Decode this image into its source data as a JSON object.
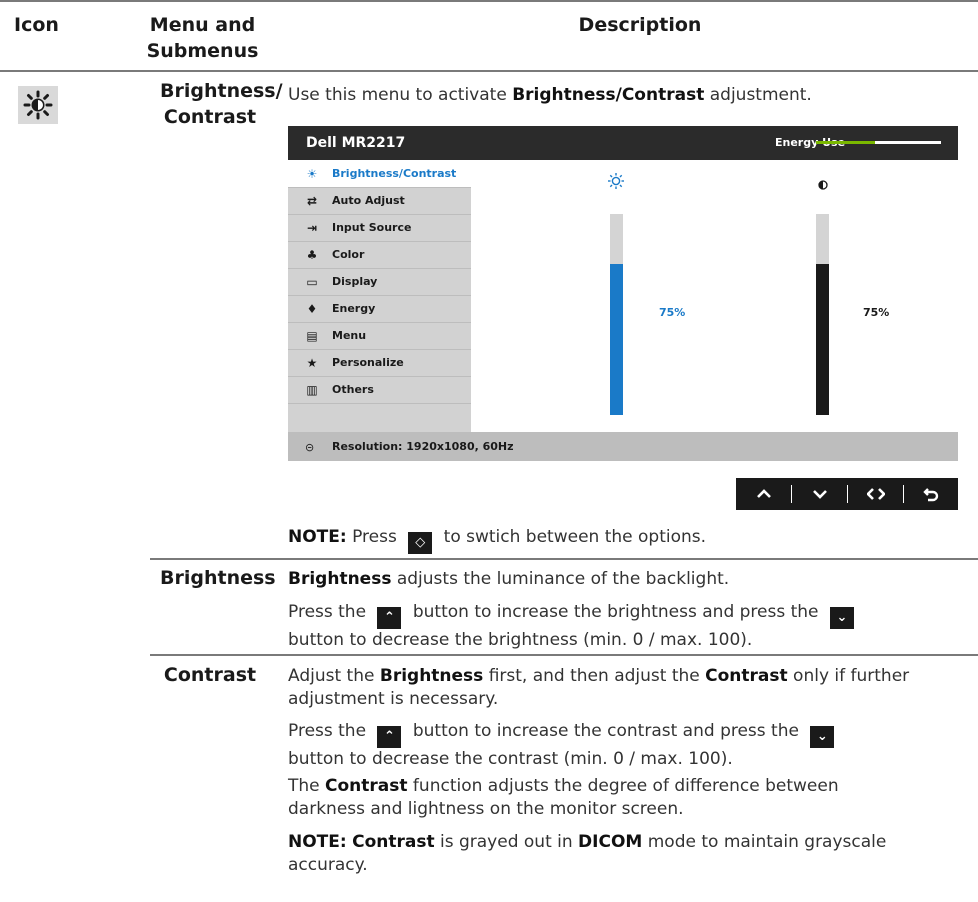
{
  "table": {
    "headers": {
      "icon": "Icon",
      "menu": "Menu and\nSubmenus",
      "menu_line1": "Menu and",
      "menu_line2": "Submenus",
      "description": "Description"
    }
  },
  "rows": {
    "brightness_contrast": {
      "menu_line1": "Brightness/",
      "menu_line2": "Contrast",
      "intro_prefix": "Use this menu to activate ",
      "intro_bold": "Brightness/Contrast",
      "intro_suffix": " adjustment.",
      "note_label": "NOTE:",
      "note_pre": " Press ",
      "note_post": " to swtich between the options."
    },
    "brightness": {
      "menu": "Brightness",
      "p1_bold": "Brightness",
      "p1_rest": " adjusts the luminance of the backlight.",
      "p2_pre": "Press the ",
      "p2_mid": " button to increase the brightness and press the ",
      "p2_line2": "button to decrease the brightness (min. 0 / max. 100)."
    },
    "contrast": {
      "menu": "Contrast",
      "p1_a": "Adjust the ",
      "p1_b": "Brightness",
      "p1_c": " first, and then adjust the ",
      "p1_d": "Contrast",
      "p1_e": " only if further",
      "p1_line2": "adjustment is necessary.",
      "p2_pre": "Press the ",
      "p2_mid": " button to increase the contrast and press the ",
      "p2_line2": "button to decrease the contrast (min. 0 / max. 100).",
      "p3_a": "The ",
      "p3_b": "Contrast",
      "p3_c": " function adjusts the degree of difference between",
      "p3_line2": "darkness and lightness on the monitor screen.",
      "note_label": "NOTE:",
      "note_b": "Contrast",
      "note_c": " is grayed out in ",
      "note_d": "DICOM",
      "note_e": " mode to maintain grayscale",
      "note_line2": "accuracy."
    }
  },
  "osd": {
    "title": "Dell MR2217",
    "energy_label": "Energy Use",
    "energy_level": 0.47,
    "menu_items": [
      {
        "label": "Brightness/Contrast",
        "icon": "sun-icon",
        "glyph": "☀",
        "active": true
      },
      {
        "label": "Auto Adjust",
        "icon": "auto-adjust-icon",
        "glyph": "⇄",
        "active": false
      },
      {
        "label": "Input Source",
        "icon": "input-source-icon",
        "glyph": "⇥",
        "active": false
      },
      {
        "label": "Color",
        "icon": "color-icon",
        "glyph": "♣",
        "active": false
      },
      {
        "label": "Display",
        "icon": "display-icon",
        "glyph": "▭",
        "active": false
      },
      {
        "label": "Energy",
        "icon": "energy-icon",
        "glyph": "♦",
        "active": false
      },
      {
        "label": "Menu",
        "icon": "menu-icon",
        "glyph": "▤",
        "active": false
      },
      {
        "label": "Personalize",
        "icon": "star-icon",
        "glyph": "★",
        "active": false
      },
      {
        "label": "Others",
        "icon": "others-icon",
        "glyph": "▥",
        "active": false
      }
    ],
    "brightness_value": "75%",
    "brightness_level": 0.75,
    "contrast_value": "75%",
    "contrast_level": 0.75,
    "status": "Resolution: 1920x1080, 60Hz",
    "colors": {
      "accent": "#1a7ac8",
      "energy": "#7ab800",
      "osd_bg": "#2b2b2b",
      "menu_bg": "#d2d2d2"
    }
  },
  "nav_buttons": [
    {
      "name": "up-button",
      "icon": "chevron-up-icon",
      "glyph": "⌃"
    },
    {
      "name": "down-button",
      "icon": "chevron-down-icon",
      "glyph": "⌄"
    },
    {
      "name": "switch-button",
      "icon": "switch-icon",
      "glyph": "◇"
    },
    {
      "name": "back-button",
      "icon": "back-icon",
      "glyph": "↶"
    }
  ]
}
